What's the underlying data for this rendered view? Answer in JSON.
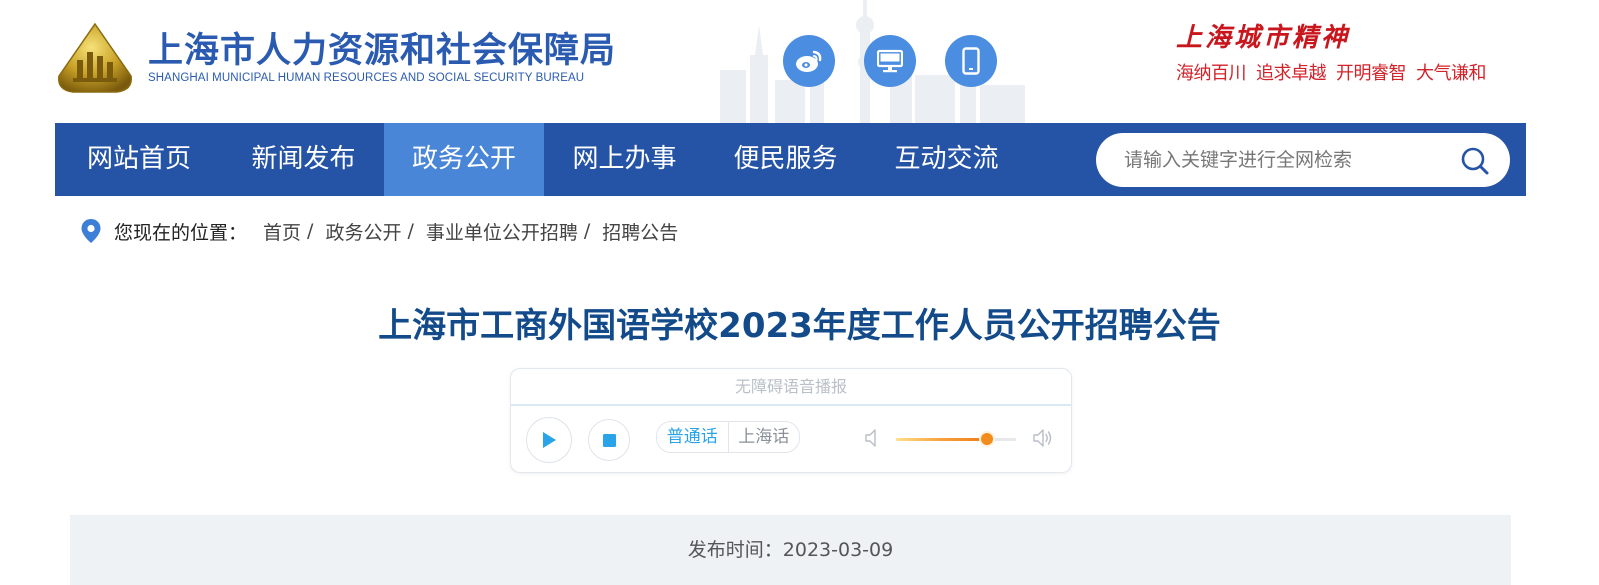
{
  "header": {
    "site_title": "上海市人力资源和社会保障局",
    "site_subtitle": "SHANGHAI MUNICIPAL HUMAN RESOURCES AND SOCIAL SECURITY BUREAU",
    "logo_icon": "hrss-emblem-icon",
    "social_buttons": [
      {
        "icon": "weibo-icon"
      },
      {
        "icon": "desktop-icon"
      },
      {
        "icon": "mobile-icon"
      }
    ],
    "spirit": {
      "title": "上海城市精神",
      "motto": [
        "海纳百川",
        "追求卓越",
        "开明睿智",
        "大气谦和"
      ]
    }
  },
  "nav": {
    "items": [
      {
        "label": "网站首页",
        "active": false
      },
      {
        "label": "新闻发布",
        "active": false
      },
      {
        "label": "政务公开",
        "active": true
      },
      {
        "label": "网上办事",
        "active": false
      },
      {
        "label": "便民服务",
        "active": false
      },
      {
        "label": "互动交流",
        "active": false
      }
    ],
    "search": {
      "placeholder": "请输入关键字进行全网检索",
      "value": ""
    }
  },
  "breadcrumb": {
    "label": "您现在的位置：",
    "items": [
      "首页",
      "政务公开",
      "事业单位公开招聘",
      "招聘公告"
    ],
    "separator": "/"
  },
  "article": {
    "title": "上海市工商外国语学校2023年度工作人员公开招聘公告",
    "publish_time": "发布时间：2023-03-09"
  },
  "player": {
    "title": "无障碍语音播报",
    "languages": [
      {
        "label": "普通话",
        "selected": true
      },
      {
        "label": "上海话",
        "selected": false
      }
    ],
    "volume": 0.76
  },
  "colors": {
    "brand_blue": "#2553a5",
    "nav_active": "#4a86d8",
    "title_blue": "#124a8a",
    "spirit_red": "#c9161d",
    "player_accent": "#2aa4e8",
    "volume_orange": "#f28c1c"
  }
}
